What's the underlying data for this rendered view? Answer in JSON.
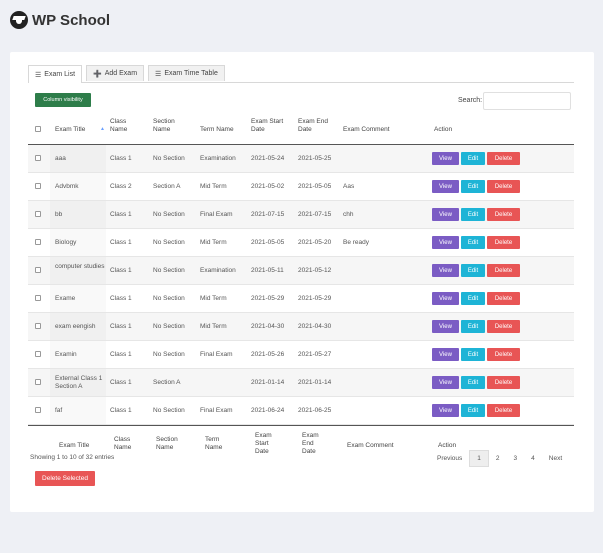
{
  "app": {
    "title": "WP School"
  },
  "tabs": [
    {
      "label": "Exam List",
      "icon": "list-icon"
    },
    {
      "label": "Add Exam",
      "icon": "plus-circle-icon"
    },
    {
      "label": "Exam Time Table",
      "icon": "list-icon"
    }
  ],
  "toolbar": {
    "column_visibility_label": "Column visibility",
    "search_label": "Search:",
    "search_value": ""
  },
  "table": {
    "header": [
      "Exam Title",
      "Class Name",
      "Section Name",
      "Term Name",
      "Exam Start Date",
      "Exam End Date",
      "Exam Comment",
      "Action"
    ],
    "rows": [
      {
        "title": "aaa",
        "class": "Class 1",
        "section": "No Section",
        "term": "Examination",
        "start": "2021-05-24",
        "end": "2021-05-25",
        "comment": ""
      },
      {
        "title": "Advbmk",
        "class": "Class 2",
        "section": "Section A",
        "term": "Mid Term",
        "start": "2021-05-02",
        "end": "2021-05-05",
        "comment": "Aas"
      },
      {
        "title": "bb",
        "class": "Class 1",
        "section": "No Section",
        "term": "Final Exam",
        "start": "2021-07-15",
        "end": "2021-07-15",
        "comment": "chh"
      },
      {
        "title": "Biology",
        "class": "Class 1",
        "section": "No Section",
        "term": "Mid Term",
        "start": "2021-05-05",
        "end": "2021-05-20",
        "comment": "Be ready"
      },
      {
        "title": "computer studies",
        "class": "Class 1",
        "section": "No Section",
        "term": "Examination",
        "start": "2021-05-11",
        "end": "2021-05-12",
        "comment": ""
      },
      {
        "title": "Exame",
        "class": "Class 1",
        "section": "No Section",
        "term": "Mid Term",
        "start": "2021-05-29",
        "end": "2021-05-29",
        "comment": ""
      },
      {
        "title": "exam eengish",
        "class": "Class 1",
        "section": "No Section",
        "term": "Mid Term",
        "start": "2021-04-30",
        "end": "2021-04-30",
        "comment": ""
      },
      {
        "title": "Examin",
        "class": "Class 1",
        "section": "No Section",
        "term": "Final Exam",
        "start": "2021-05-26",
        "end": "2021-05-27",
        "comment": ""
      },
      {
        "title": "External Class 1 Section A",
        "class": "Class 1",
        "section": "Section A",
        "term": "",
        "start": "2021-01-14",
        "end": "2021-01-14",
        "comment": ""
      },
      {
        "title": "faf",
        "class": "Class 1",
        "section": "No Section",
        "term": "Final Exam",
        "start": "2021-06-24",
        "end": "2021-06-25",
        "comment": ""
      }
    ],
    "actions": {
      "view": "View",
      "edit": "Edit",
      "delete": "Delete"
    }
  },
  "footer": {
    "info": "Showing 1 to 10 of 32 entries",
    "pagination": [
      "Previous",
      "1",
      "2",
      "3",
      "4",
      "Next"
    ],
    "active_page": "1",
    "delete_selected_label": "Delete Selected"
  },
  "colors": {
    "view": "#7b5cc4",
    "edit": "#1eb4d6",
    "delete": "#e85555",
    "column_visibility": "#2e7d4a"
  }
}
